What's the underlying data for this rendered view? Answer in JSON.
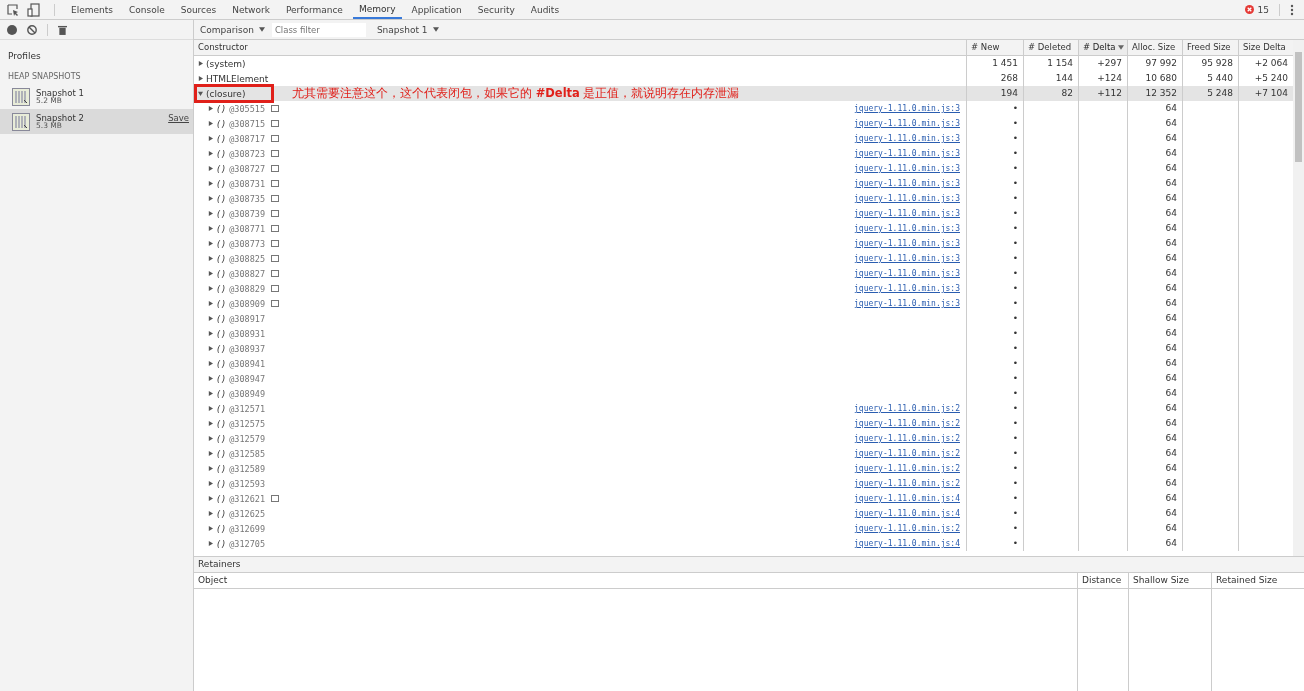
{
  "tabs": [
    {
      "label": "Elements",
      "selected": false
    },
    {
      "label": "Console",
      "selected": false
    },
    {
      "label": "Sources",
      "selected": false
    },
    {
      "label": "Network",
      "selected": false
    },
    {
      "label": "Performance",
      "selected": false
    },
    {
      "label": "Memory",
      "selected": true
    },
    {
      "label": "Application",
      "selected": false
    },
    {
      "label": "Security",
      "selected": false
    },
    {
      "label": "Audits",
      "selected": false
    }
  ],
  "error_count": "15",
  "sidebar": {
    "title": "Profiles",
    "section": "HEAP SNAPSHOTS",
    "items": [
      {
        "name": "Snapshot 1",
        "size": "5.2 MB",
        "selected": false
      },
      {
        "name": "Snapshot 2",
        "size": "5.3 MB",
        "selected": true,
        "action": "Save"
      }
    ]
  },
  "toolbar": {
    "view": "Comparison",
    "filter_placeholder": "Class filter",
    "baseline": "Snapshot 1"
  },
  "table": {
    "columns": [
      {
        "label": "Constructor",
        "sorted": false
      },
      {
        "label": "# New",
        "sorted": false
      },
      {
        "label": "# Deleted",
        "sorted": false
      },
      {
        "label": "# Delta",
        "sorted": true
      },
      {
        "label": "Alloc. Size",
        "sorted": false
      },
      {
        "label": "Freed Size",
        "sorted": false
      },
      {
        "label": "Size Delta",
        "sorted": false
      }
    ],
    "rows": [
      {
        "name": "(system)",
        "expanded": false,
        "selected": false,
        "highlight": false,
        "values": [
          "1 451",
          "1 154",
          "+297",
          "97 992",
          "95 928",
          "+2 064"
        ]
      },
      {
        "name": "HTMLElement",
        "expanded": false,
        "selected": false,
        "highlight": false,
        "values": [
          "268",
          "144",
          "+124",
          "10 680",
          "5 440",
          "+5 240"
        ]
      },
      {
        "name": "(closure)",
        "expanded": true,
        "selected": true,
        "highlight": true,
        "note": "尤其需要注意这个，这个代表闭包，如果它的 **#Delta** 是正值，就说明存在内存泄漏",
        "values": [
          "194",
          "82",
          "+112",
          "12 352",
          "5 248",
          "+7 104"
        ],
        "children": [
          {
            "name": "()",
            "id": "@305515",
            "expanded": false,
            "marker": true,
            "link": "jquery-1.11.0.min.js:3",
            "new": "•",
            "alloc": "64"
          },
          {
            "name": "()",
            "id": "@308715",
            "expanded": false,
            "marker": true,
            "link": "jquery-1.11.0.min.js:3",
            "new": "•",
            "alloc": "64"
          },
          {
            "name": "()",
            "id": "@308717",
            "expanded": false,
            "marker": true,
            "link": "jquery-1.11.0.min.js:3",
            "new": "•",
            "alloc": "64"
          },
          {
            "name": "()",
            "id": "@308723",
            "expanded": false,
            "marker": true,
            "link": "jquery-1.11.0.min.js:3",
            "new": "•",
            "alloc": "64"
          },
          {
            "name": "()",
            "id": "@308727",
            "expanded": false,
            "marker": true,
            "link": "jquery-1.11.0.min.js:3",
            "new": "•",
            "alloc": "64"
          },
          {
            "name": "()",
            "id": "@308731",
            "expanded": false,
            "marker": true,
            "link": "jquery-1.11.0.min.js:3",
            "new": "•",
            "alloc": "64"
          },
          {
            "name": "()",
            "id": "@308735",
            "expanded": false,
            "marker": true,
            "link": "jquery-1.11.0.min.js:3",
            "new": "•",
            "alloc": "64"
          },
          {
            "name": "()",
            "id": "@308739",
            "expanded": false,
            "marker": true,
            "link": "jquery-1.11.0.min.js:3",
            "new": "•",
            "alloc": "64"
          },
          {
            "name": "()",
            "id": "@308771",
            "expanded": false,
            "marker": true,
            "link": "jquery-1.11.0.min.js:3",
            "new": "•",
            "alloc": "64"
          },
          {
            "name": "()",
            "id": "@308773",
            "expanded": false,
            "marker": true,
            "link": "jquery-1.11.0.min.js:3",
            "new": "•",
            "alloc": "64"
          },
          {
            "name": "()",
            "id": "@308825",
            "expanded": false,
            "marker": true,
            "link": "jquery-1.11.0.min.js:3",
            "new": "•",
            "alloc": "64"
          },
          {
            "name": "()",
            "id": "@308827",
            "expanded": false,
            "marker": true,
            "link": "jquery-1.11.0.min.js:3",
            "new": "•",
            "alloc": "64"
          },
          {
            "name": "()",
            "id": "@308829",
            "expanded": false,
            "marker": true,
            "link": "jquery-1.11.0.min.js:3",
            "new": "•",
            "alloc": "64"
          },
          {
            "name": "()",
            "id": "@308909",
            "expanded": false,
            "marker": true,
            "link": "jquery-1.11.0.min.js:3",
            "new": "•",
            "alloc": "64"
          },
          {
            "name": "()",
            "id": "@308917",
            "expanded": false,
            "marker": false,
            "new": "•",
            "alloc": "64"
          },
          {
            "name": "()",
            "id": "@308931",
            "expanded": false,
            "marker": false,
            "new": "•",
            "alloc": "64"
          },
          {
            "name": "()",
            "id": "@308937",
            "expanded": false,
            "marker": false,
            "new": "•",
            "alloc": "64"
          },
          {
            "name": "()",
            "id": "@308941",
            "expanded": false,
            "marker": false,
            "new": "•",
            "alloc": "64"
          },
          {
            "name": "()",
            "id": "@308947",
            "expanded": false,
            "marker": false,
            "new": "•",
            "alloc": "64"
          },
          {
            "name": "()",
            "id": "@308949",
            "expanded": false,
            "marker": false,
            "new": "•",
            "alloc": "64"
          },
          {
            "name": "()",
            "id": "@312571",
            "expanded": false,
            "marker": false,
            "link": "jquery-1.11.0.min.js:2",
            "new": "•",
            "alloc": "64"
          },
          {
            "name": "()",
            "id": "@312575",
            "expanded": false,
            "marker": false,
            "link": "jquery-1.11.0.min.js:2",
            "new": "•",
            "alloc": "64"
          },
          {
            "name": "()",
            "id": "@312579",
            "expanded": false,
            "marker": false,
            "link": "jquery-1.11.0.min.js:2",
            "new": "•",
            "alloc": "64"
          },
          {
            "name": "()",
            "id": "@312585",
            "expanded": false,
            "marker": false,
            "link": "jquery-1.11.0.min.js:2",
            "new": "•",
            "alloc": "64"
          },
          {
            "name": "()",
            "id": "@312589",
            "expanded": false,
            "marker": false,
            "link": "jquery-1.11.0.min.js:2",
            "new": "•",
            "alloc": "64"
          },
          {
            "name": "()",
            "id": "@312593",
            "expanded": false,
            "marker": false,
            "link": "jquery-1.11.0.min.js:2",
            "new": "•",
            "alloc": "64"
          },
          {
            "name": "()",
            "id": "@312621",
            "expanded": false,
            "marker": true,
            "link": "jquery-1.11.0.min.js:4",
            "new": "•",
            "alloc": "64"
          },
          {
            "name": "()",
            "id": "@312625",
            "expanded": false,
            "marker": false,
            "link": "jquery-1.11.0.min.js:4",
            "new": "•",
            "alloc": "64"
          },
          {
            "name": "()",
            "id": "@312699",
            "expanded": false,
            "marker": false,
            "link": "jquery-1.11.0.min.js:2",
            "new": "•",
            "alloc": "64"
          },
          {
            "name": "()",
            "id": "@312705",
            "expanded": false,
            "marker": false,
            "link": "jquery-1.11.0.min.js:4",
            "new": "•",
            "alloc": "64"
          }
        ]
      }
    ]
  },
  "retainers": {
    "title": "Retainers",
    "columns": [
      "Object",
      "Distance",
      "Shallow Size",
      "Retained Size"
    ]
  }
}
